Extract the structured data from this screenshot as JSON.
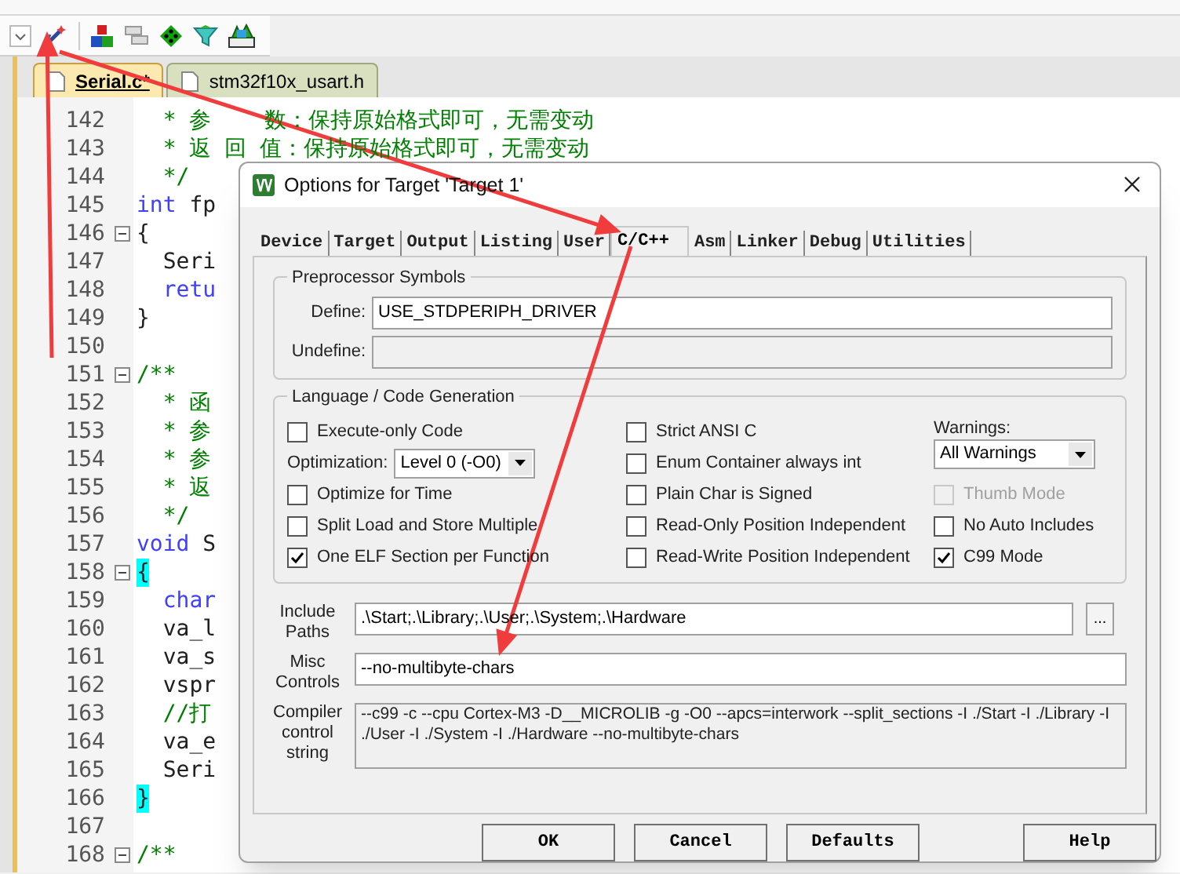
{
  "editor_tabs": [
    {
      "label": "Serial.c*",
      "selected": true
    },
    {
      "label": "stm32f10x_usart.h",
      "selected": false
    }
  ],
  "code_lines": [
    {
      "number": "142",
      "collapsible": false,
      "tokens": [
        {
          "text": "  * 参    数：保持原始格式即可，无需变动",
          "kind": "comment"
        }
      ]
    },
    {
      "number": "143",
      "collapsible": false,
      "tokens": [
        {
          "text": "  * 返 回 值：保持原始格式即可，无需变动",
          "kind": "comment"
        }
      ]
    },
    {
      "number": "144",
      "collapsible": false,
      "tokens": [
        {
          "text": "  */",
          "kind": "comment"
        }
      ]
    },
    {
      "number": "145",
      "collapsible": false,
      "tokens": [
        {
          "text": "int",
          "kind": "keyword"
        },
        {
          "text": " fp",
          "kind": "plain"
        }
      ]
    },
    {
      "number": "146",
      "collapsible": true,
      "tokens": [
        {
          "text": "{",
          "kind": "plain"
        }
      ]
    },
    {
      "number": "147",
      "collapsible": false,
      "tokens": [
        {
          "text": "  Seri",
          "kind": "plain"
        }
      ]
    },
    {
      "number": "148",
      "collapsible": false,
      "tokens": [
        {
          "text": "  retu",
          "kind": "keyword"
        }
      ]
    },
    {
      "number": "149",
      "collapsible": false,
      "tokens": [
        {
          "text": "}",
          "kind": "plain"
        }
      ]
    },
    {
      "number": "150",
      "collapsible": false
    },
    {
      "number": "151",
      "collapsible": true,
      "tokens": [
        {
          "text": "/**",
          "kind": "comment"
        }
      ]
    },
    {
      "number": "152",
      "collapsible": false,
      "tokens": [
        {
          "text": "  * 函",
          "kind": "comment"
        }
      ]
    },
    {
      "number": "153",
      "collapsible": false,
      "tokens": [
        {
          "text": "  * 参",
          "kind": "comment"
        }
      ]
    },
    {
      "number": "154",
      "collapsible": false,
      "tokens": [
        {
          "text": "  * 参",
          "kind": "comment"
        }
      ]
    },
    {
      "number": "155",
      "collapsible": false,
      "tokens": [
        {
          "text": "  * 返",
          "kind": "comment"
        }
      ]
    },
    {
      "number": "156",
      "collapsible": false,
      "tokens": [
        {
          "text": "  */",
          "kind": "comment"
        }
      ]
    },
    {
      "number": "157",
      "collapsible": false,
      "tokens": [
        {
          "text": "void",
          "kind": "keyword"
        },
        {
          "text": " S",
          "kind": "plain"
        }
      ]
    },
    {
      "number": "158",
      "collapsible": true,
      "tokens": [
        {
          "text": "{",
          "kind": "brace_match"
        }
      ]
    },
    {
      "number": "159",
      "collapsible": false,
      "tokens": [
        {
          "text": "  char",
          "kind": "keyword"
        }
      ]
    },
    {
      "number": "160",
      "collapsible": false,
      "tokens": [
        {
          "text": "  va_l",
          "kind": "plain"
        }
      ]
    },
    {
      "number": "161",
      "collapsible": false,
      "tokens": [
        {
          "text": "  va_s",
          "kind": "plain"
        }
      ]
    },
    {
      "number": "162",
      "collapsible": false,
      "tokens": [
        {
          "text": "  vspr",
          "kind": "plain"
        }
      ]
    },
    {
      "number": "163",
      "collapsible": false,
      "tokens": [
        {
          "text": "  //打",
          "kind": "comment"
        }
      ]
    },
    {
      "number": "164",
      "collapsible": false,
      "tokens": [
        {
          "text": "  va_e",
          "kind": "plain"
        }
      ]
    },
    {
      "number": "165",
      "collapsible": false,
      "tokens": [
        {
          "text": "  Seri",
          "kind": "plain"
        }
      ]
    },
    {
      "number": "166",
      "collapsible": false,
      "tokens": [
        {
          "text": "}",
          "kind": "brace_match"
        }
      ]
    },
    {
      "number": "167",
      "collapsible": false
    },
    {
      "number": "168",
      "collapsible": true,
      "tokens": [
        {
          "text": "/**",
          "kind": "comment"
        }
      ]
    }
  ],
  "dialog": {
    "title": "Options for Target 'Target 1'",
    "tabs": [
      {
        "label": "Device",
        "selected": false
      },
      {
        "label": "Target",
        "selected": false
      },
      {
        "label": "Output",
        "selected": false
      },
      {
        "label": "Listing",
        "selected": false
      },
      {
        "label": "User",
        "selected": false
      },
      {
        "label": "C/C++",
        "selected": true
      },
      {
        "label": "Asm",
        "selected": false
      },
      {
        "label": "Linker",
        "selected": false
      },
      {
        "label": "Debug",
        "selected": false
      },
      {
        "label": "Utilities",
        "selected": false
      }
    ],
    "preprocessor": {
      "title": "Preprocessor Symbols",
      "define": {
        "label": "Define:",
        "value": "USE_STDPERIPH_DRIVER",
        "disabled": false
      },
      "undefine": {
        "label": "Undefine:",
        "disabled": true
      }
    },
    "language": {
      "title": "Language / Code Generation",
      "column_1": [
        {
          "kind": "checkbox",
          "label": "Execute-only Code",
          "checked": false,
          "disabled": false
        },
        {
          "kind": "select",
          "label": "Optimization:",
          "value": "Level 0 (-O0)"
        },
        {
          "kind": "checkbox",
          "label": "Optimize for Time",
          "checked": false,
          "disabled": false
        },
        {
          "kind": "checkbox",
          "label": "Split Load and Store Multiple",
          "checked": false,
          "disabled": false
        },
        {
          "kind": "checkbox",
          "label": "One ELF Section per Function",
          "checked": true,
          "disabled": false
        }
      ],
      "column_2": [
        {
          "kind": "checkbox",
          "label": "Strict ANSI C",
          "checked": false,
          "disabled": false
        },
        {
          "kind": "checkbox",
          "label": "Enum Container always int",
          "checked": false,
          "disabled": false
        },
        {
          "kind": "checkbox",
          "label": "Plain Char is Signed",
          "checked": false,
          "disabled": false
        },
        {
          "kind": "checkbox",
          "label": "Read-Only Position Independent",
          "checked": false,
          "disabled": false
        },
        {
          "kind": "checkbox",
          "label": "Read-Write Position Independent",
          "checked": false,
          "disabled": false
        }
      ],
      "column_3": [
        {
          "kind": "stacked_select",
          "label": "Warnings:",
          "value": "All Warnings"
        },
        {
          "kind": "checkbox",
          "label": "Thumb Mode",
          "checked": false,
          "disabled": true
        },
        {
          "kind": "checkbox",
          "label": "No Auto Includes",
          "checked": false,
          "disabled": false
        },
        {
          "kind": "checkbox",
          "label": "C99 Mode",
          "checked": true,
          "disabled": false
        }
      ]
    },
    "include_paths": {
      "label": "Include Paths",
      "value": ".\\Start;.\\Library;.\\User;.\\System;.\\Hardware",
      "browse": "..."
    },
    "misc_controls": {
      "label": "Misc Controls",
      "value": "--no-multibyte-chars"
    },
    "compiler_string": {
      "label": "Compiler control string",
      "value": "--c99 -c --cpu Cortex-M3 -D__MICROLIB -g -O0 --apcs=interwork --split_sections -I ./Start -I ./Library -I ./User -I ./System -I ./Hardware --no-multibyte-chars"
    },
    "buttons": [
      "OK",
      "Cancel",
      "Defaults",
      "Help"
    ]
  }
}
